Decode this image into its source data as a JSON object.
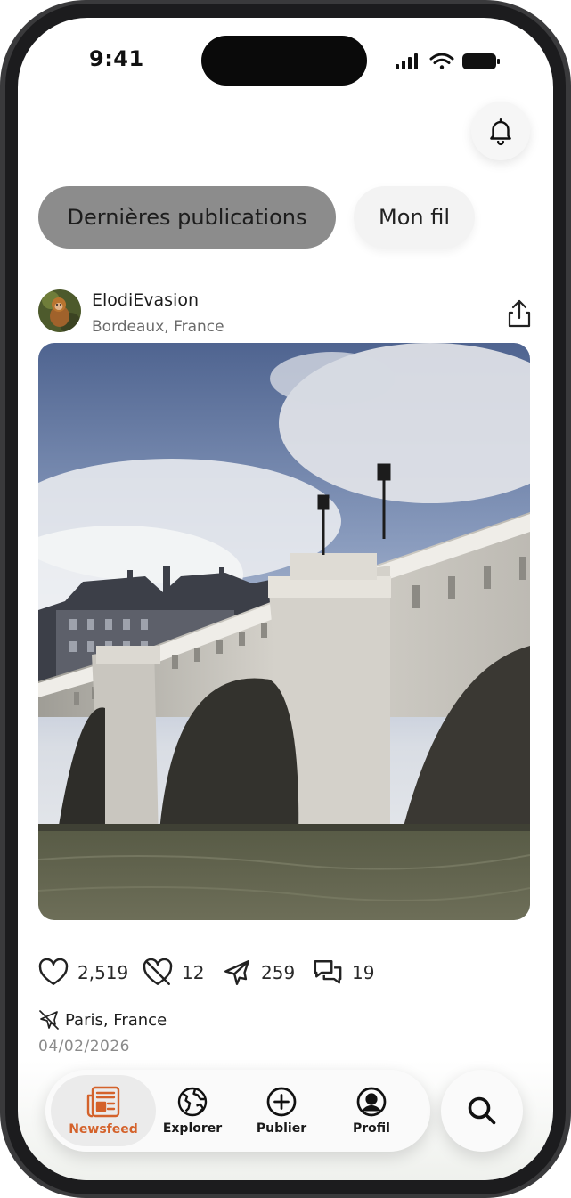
{
  "status_bar": {
    "time": "9:41"
  },
  "tabs": [
    {
      "label": "Dernières publications",
      "selected": true
    },
    {
      "label": "Mon fil",
      "selected": false
    }
  ],
  "post": {
    "username": "ElodiEvasion",
    "user_location": "Bordeaux, France",
    "stats": {
      "likes": "2,519",
      "dislikes": "12",
      "trips": "259",
      "comments": "19"
    },
    "place": "Paris, France",
    "date": "04/02/2026"
  },
  "nav": {
    "items": [
      {
        "label": "Newsfeed",
        "icon": "newspaper-icon",
        "active": true
      },
      {
        "label": "Explorer",
        "icon": "globe-icon",
        "active": false
      },
      {
        "label": "Publier",
        "icon": "plus-circle-icon",
        "active": false
      },
      {
        "label": "Profil",
        "icon": "user-circle-icon",
        "active": false
      }
    ],
    "search_icon": "search-icon"
  },
  "colors": {
    "accent": "#d4622b",
    "selected_tab": "#8c8c8c",
    "unselected_tab": "#f3f3f3"
  }
}
